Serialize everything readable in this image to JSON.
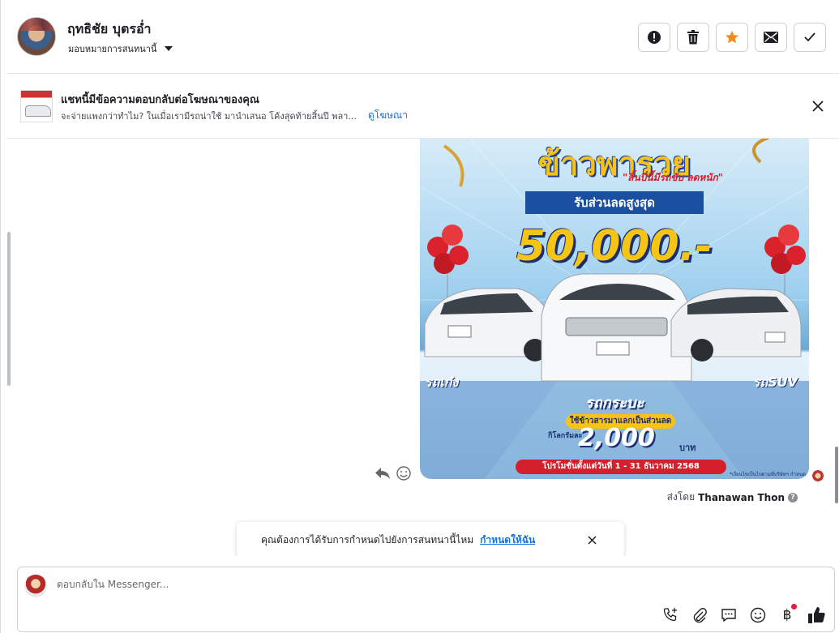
{
  "header": {
    "contact_name": "ฤทธิชัย บุตรอ่ำ",
    "assign_label": "มอบหมายการสนทนานี้",
    "toolbar": [
      {
        "name": "report-spam-button",
        "icon": "alert-icon"
      },
      {
        "name": "delete-button",
        "icon": "trash-icon"
      },
      {
        "name": "star-button",
        "icon": "star-icon"
      },
      {
        "name": "mark-unread-button",
        "icon": "envelope-icon"
      },
      {
        "name": "mark-done-button",
        "icon": "checkmark-icon"
      }
    ],
    "star_color": "#f28b22"
  },
  "ad_banner": {
    "title": "แชทนี้มีข้อความตอบกลับต่อโฆษณาของคุณ",
    "description": "จะจ่ายแพงกว่าทำไม? ในเมื่อเรามีรถน่าใช้ มานำเสนอ โค้งสุดท้ายสิ้นปี พลา...",
    "link_label": "ดูโฆษณา"
  },
  "message": {
    "image": {
      "headline": "ข้าวพารวย",
      "slogan": "\"สิ้นปีนี้มีรถขับ ลดหนัก\"",
      "subheadline": "รับส่วนลดสูงสุด",
      "amount": "50,000.-",
      "left_label": "รถเก๋ง",
      "right_label": "รถSUV",
      "center_label": "รถกระบะ",
      "pill": "ใช้ข้าวสารมาแลกเป็นส่วนลด",
      "per_kg": "กิโลกรัมละ",
      "price": "2,000",
      "baht": "บาท",
      "footer": "โปรโมชั่นตั้งแต่วันที่ 1 - 31 ธันวาคม 2568",
      "fine_print": "*เงื่อนไขเป็นไปตามที่บริษัทฯ กำหนด"
    },
    "sent_by_prefix": "ส่งโดย",
    "sent_by_name": "Thanawan Thon"
  },
  "assign_toast": {
    "text": "คุณต้องการได้รับการกำหนดไปยังการสนทนานี้ไหม",
    "link_label": "กำหนดให้ฉัน"
  },
  "composer": {
    "placeholder": "ตอบกลับใน Messenger...",
    "tools": [
      "phone-plus-icon",
      "paperclip-icon",
      "chat-bubble-icon",
      "emoji-icon",
      "baht-icon",
      "thumbs-up-icon"
    ]
  }
}
